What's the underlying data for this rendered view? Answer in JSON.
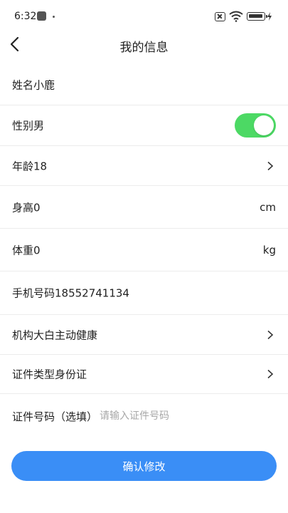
{
  "status_bar": {
    "time": "6:32"
  },
  "header": {
    "title": "我的信息"
  },
  "form": {
    "name": "姓名小鹿",
    "gender": "性别男",
    "gender_toggle_on": true,
    "age": "年龄18",
    "height": "身高0",
    "height_unit": "cm",
    "weight": "体重0",
    "weight_unit": "kg",
    "phone": "手机号码18552741134",
    "institution": "机构大白主动健康",
    "id_type": "证件类型身份证",
    "id_number_label": "证件号码（选填）",
    "id_number_value": "",
    "id_number_placeholder": "请输入证件号码"
  },
  "actions": {
    "confirm_label": "确认修改"
  },
  "colors": {
    "accent": "#3a8ef6",
    "toggle_on": "#4cd964"
  },
  "icons": [
    "back-arrow-icon",
    "chevron-right-icon",
    "wifi-icon",
    "battery-icon",
    "charging-icon",
    "no-sim-icon"
  ]
}
